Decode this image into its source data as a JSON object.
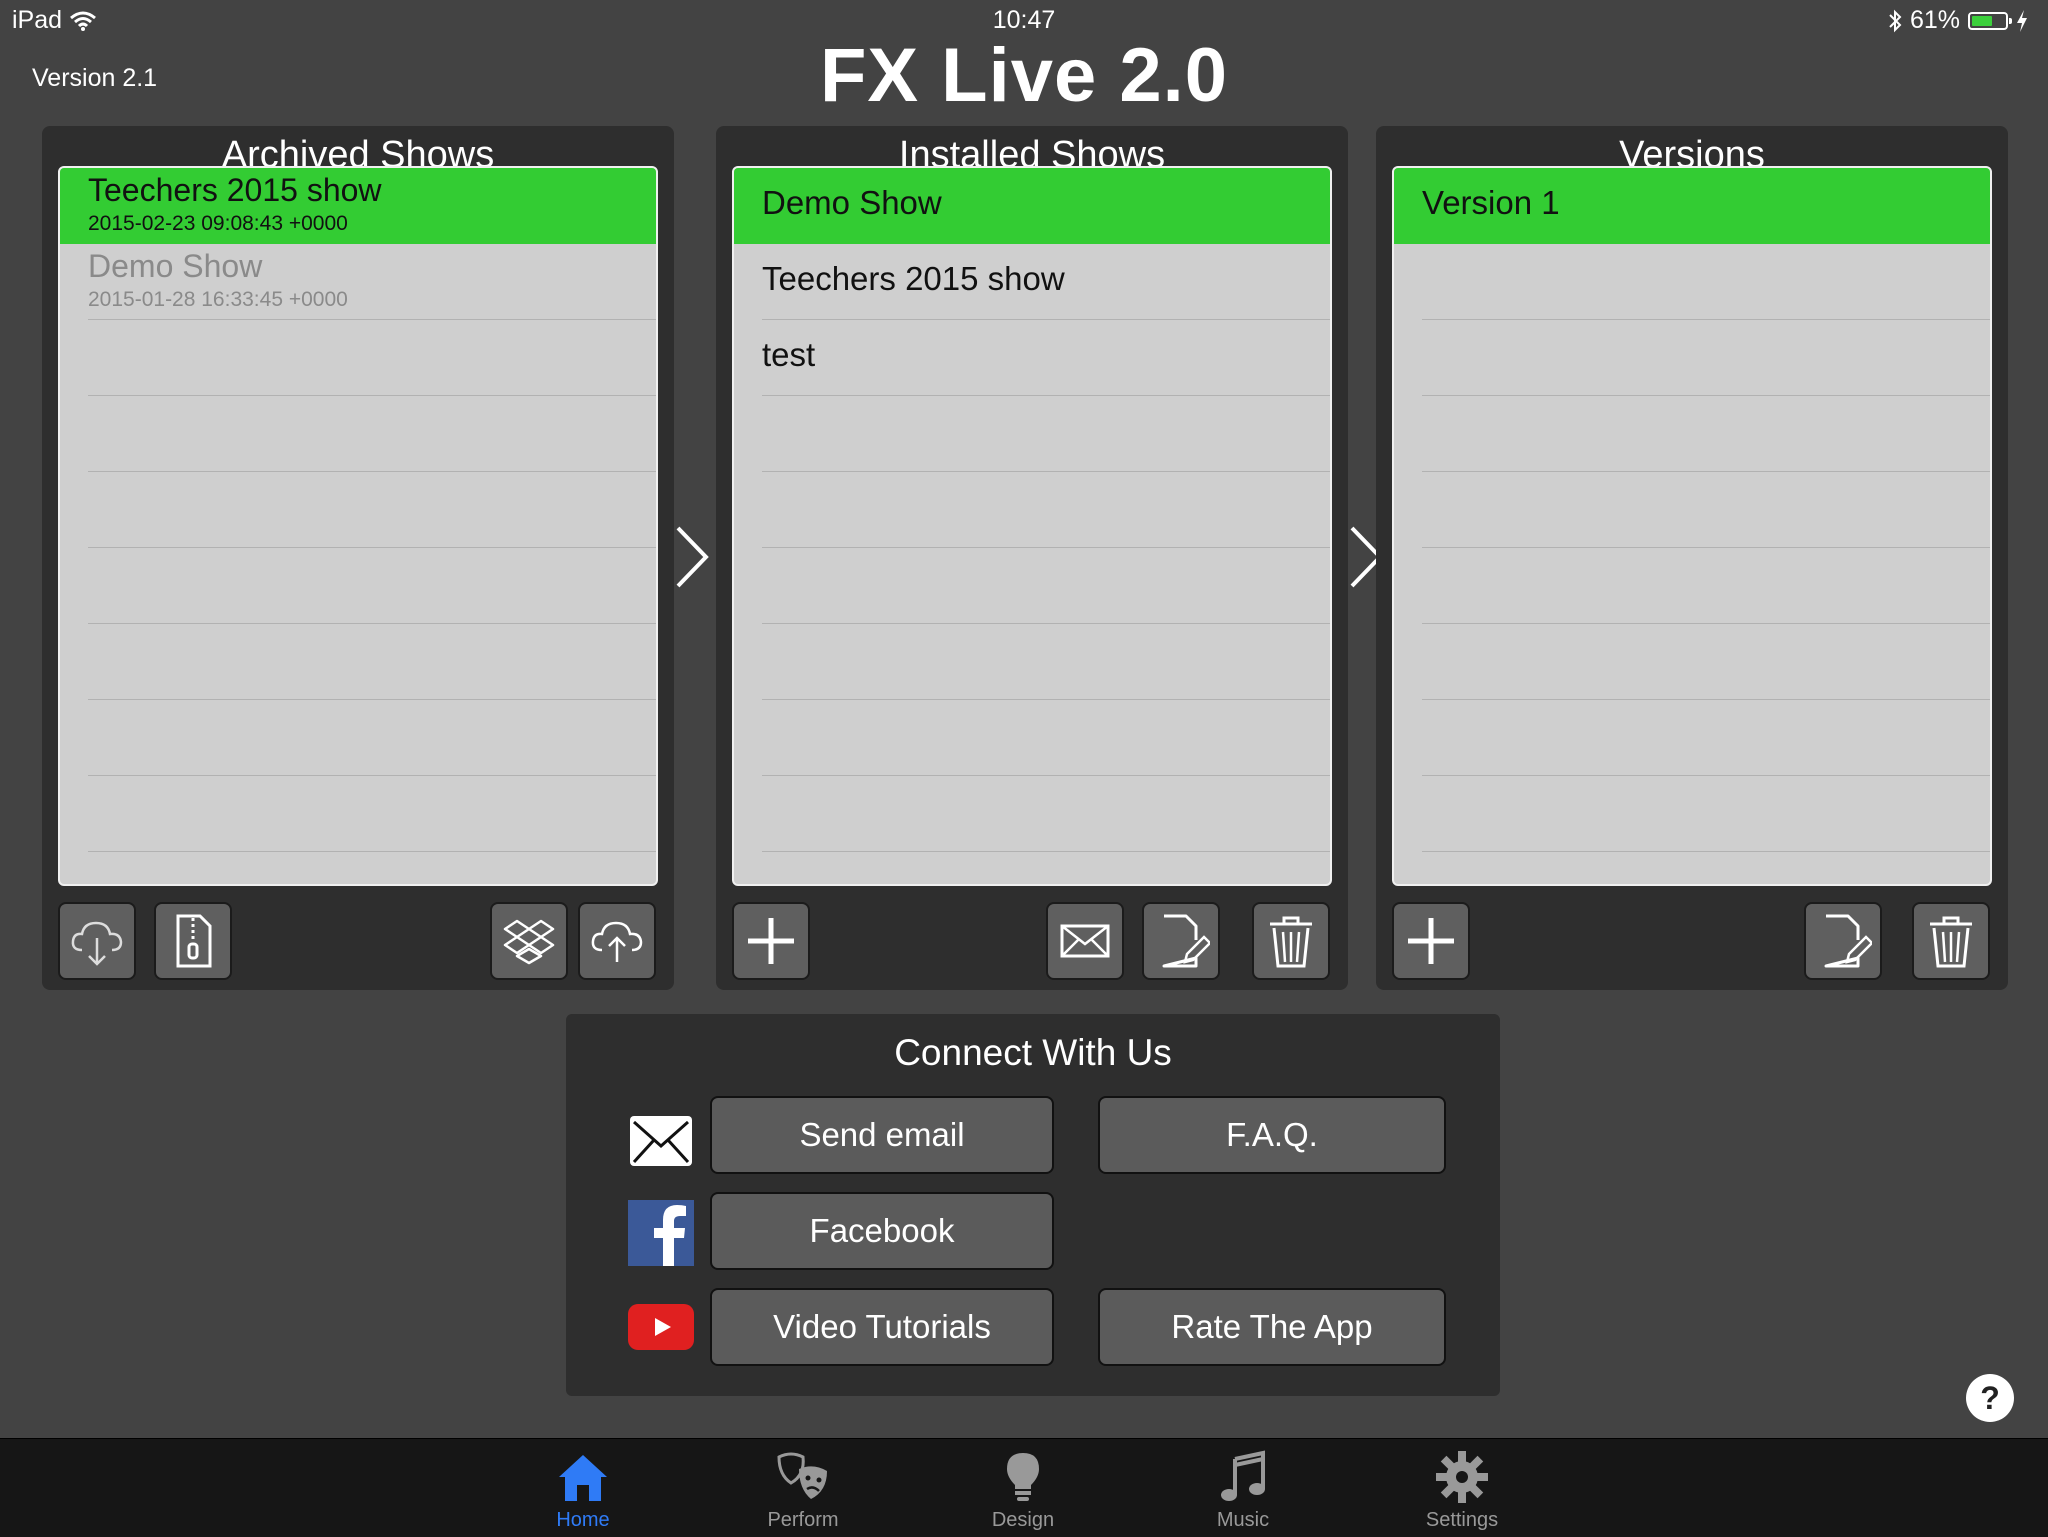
{
  "status_bar": {
    "device": "iPad",
    "time": "10:47",
    "battery": "61%",
    "battery_level": 0.61
  },
  "header": {
    "version": "Version 2.1",
    "title": "FX Live 2.0"
  },
  "archived": {
    "title": "Archived Shows",
    "rows": [
      {
        "name": "Teechers 2015 show",
        "date": "2015-02-23 09:08:43 +0000"
      },
      {
        "name": "Demo Show",
        "date": "2015-01-28 16:33:45 +0000"
      }
    ]
  },
  "installed": {
    "title": "Installed Shows",
    "rows": [
      {
        "name": "Demo Show"
      },
      {
        "name": "Teechers 2015 show"
      },
      {
        "name": "test"
      }
    ]
  },
  "versions": {
    "title": "Versions",
    "rows": [
      {
        "name": "Version 1"
      }
    ]
  },
  "connect": {
    "title": "Connect With Us",
    "send_email": "Send email",
    "faq": "F.A.Q.",
    "facebook": "Facebook",
    "video_tutorials": "Video Tutorials",
    "rate_app": "Rate The App"
  },
  "help": "?",
  "tabs": [
    {
      "label": "Home",
      "icon": "home-icon"
    },
    {
      "label": "Perform",
      "icon": "theater-masks-icon"
    },
    {
      "label": "Design",
      "icon": "lightbulb-icon"
    },
    {
      "label": "Music",
      "icon": "music-note-icon"
    },
    {
      "label": "Settings",
      "icon": "gear-icon"
    }
  ],
  "colors": {
    "selected_row": "#33cc33",
    "active_tab": "#2f7bf6",
    "background": "#434343"
  }
}
